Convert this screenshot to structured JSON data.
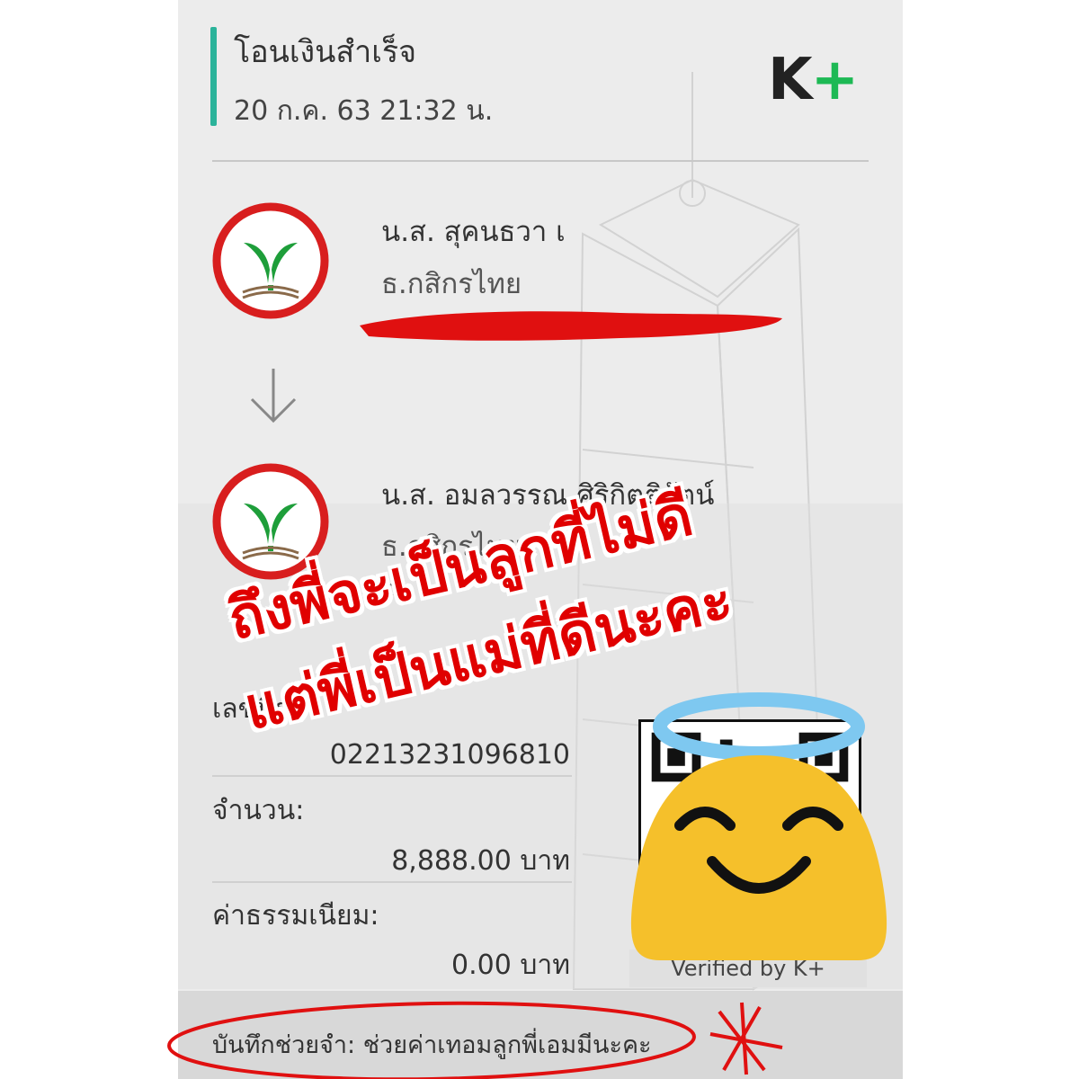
{
  "header": {
    "title": "โอนเงินสำเร็จ",
    "datetime": "20 ก.ค. 63  21:32 น.",
    "brand_k": "K",
    "brand_plus": "+"
  },
  "sender": {
    "name": "น.ส. สุคนธวา เ",
    "bank": "ธ.กสิกรไทย"
  },
  "receiver": {
    "name": "น.ส. อมลวรรณ ศิริกิตติรัตน์",
    "bank": "ธ.กสิกรไทย",
    "account_partial": "xx"
  },
  "reference": {
    "label_partial": "เลขที่ร",
    "number_partial": "02213231096810"
  },
  "amount": {
    "label": "จำนวน:",
    "value": "8,888.00 บาท"
  },
  "fee": {
    "label": "ค่าธรรมเนียม:",
    "value": "0.00 บาท"
  },
  "verified": "Verified by K+",
  "memo": "บันทึกช่วยจำ: ช่วยค่าเทอมลูกพี่เอมมีนะคะ",
  "overlay_caption": {
    "line1": "ถึงพี่จะเป็นลูกที่ไม่ดี",
    "line2": "แต่พี่เป็นแม่ที่ดีนะคะ"
  },
  "icons": [
    "kbank-logo-icon",
    "arrow-down-icon",
    "qr-code",
    "smiling-angel-emoji"
  ],
  "colors": {
    "accent_teal": "#2bb39a",
    "kbank_green": "#1e9e3a",
    "kbank_red_ring": "#d81e1e",
    "caption_red": "#e00000",
    "redaction_red": "#e01010",
    "emoji_yellow": "#f5c02b",
    "halo_blue": "#7ec8f0"
  }
}
